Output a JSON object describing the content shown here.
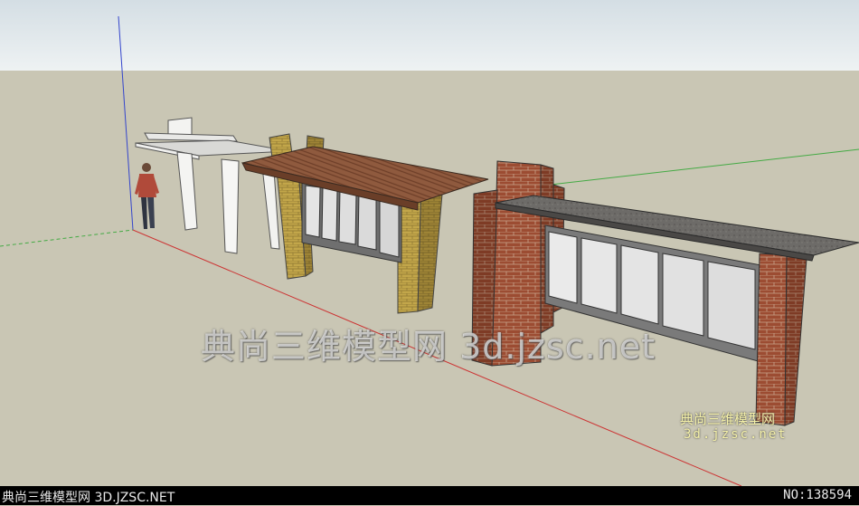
{
  "watermark": {
    "main": "典尚三维模型网 3d.jzsc.net",
    "small_cn": "典尚三维模型网",
    "small_url": "3d.jzsc.net"
  },
  "footer": {
    "left": "典尚三维模型网 3D.JZSC.NET",
    "right": "NO:138594"
  },
  "colors": {
    "sky": "#e3eaee",
    "ground": "#c9c6b4",
    "brick": "#9a4a30",
    "stone_roof": "#6a6a6a",
    "wood_roof": "#8a4a30",
    "yellow_brick": "#b8a040",
    "glass_panel": "#e6e6e6",
    "axis_red": "#cc3333",
    "axis_green": "#33aa33",
    "axis_blue": "#3333cc"
  }
}
